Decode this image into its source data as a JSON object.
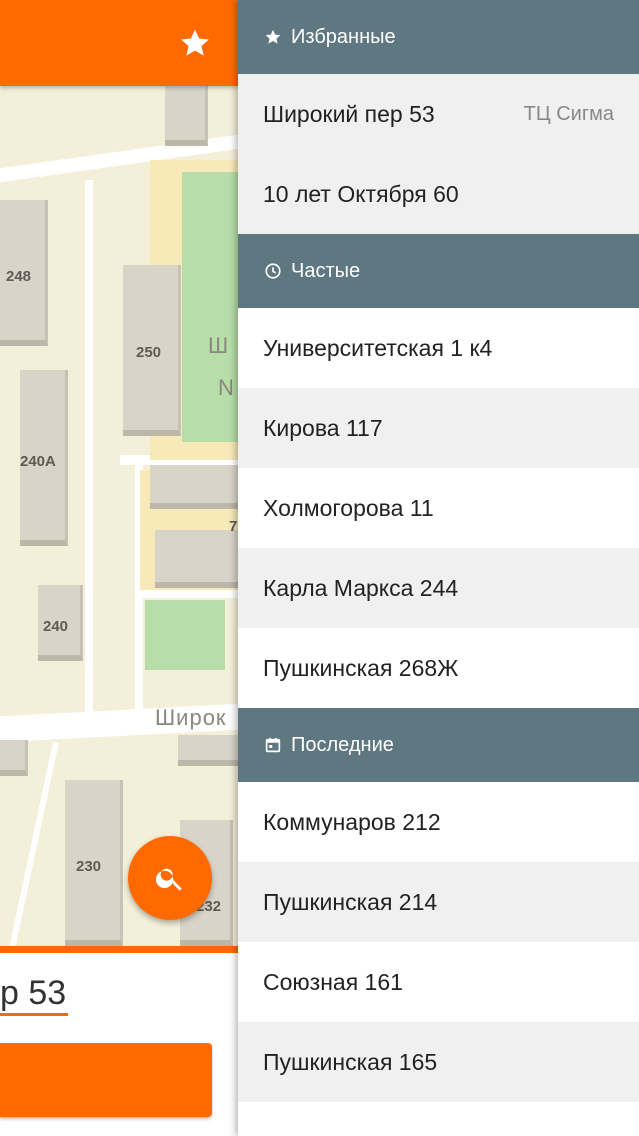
{
  "map": {
    "house_numbers": [
      "248",
      "250",
      "240А",
      "240",
      "230",
      "232",
      "7"
    ],
    "street_labels": [
      "Широк",
      "Ш",
      "N"
    ],
    "favorite_icon": "star-icon",
    "search_icon": "search-icon",
    "address_partial": "р 53",
    "colors": {
      "accent": "#ff6a00"
    }
  },
  "drawer": {
    "sections": [
      {
        "title": "Избранные",
        "icon": "star-icon",
        "items": [
          {
            "label": "Широкий пер 53",
            "note": "ТЦ Сигма"
          },
          {
            "label": "10 лет Октября 60",
            "note": ""
          }
        ]
      },
      {
        "title": "Частые",
        "icon": "clock-icon",
        "items": [
          {
            "label": "Университетская 1 к4"
          },
          {
            "label": "Кирова 117"
          },
          {
            "label": "Холмогорова 11"
          },
          {
            "label": "Карла Маркса 244"
          },
          {
            "label": "Пушкинская 268Ж"
          }
        ]
      },
      {
        "title": "Последние",
        "icon": "calendar-icon",
        "items": [
          {
            "label": "Коммунаров 212"
          },
          {
            "label": "Пушкинская 214"
          },
          {
            "label": "Союзная 161"
          },
          {
            "label": "Пушкинская 165"
          }
        ]
      }
    ],
    "colors": {
      "section_header": "#5f7780"
    }
  }
}
